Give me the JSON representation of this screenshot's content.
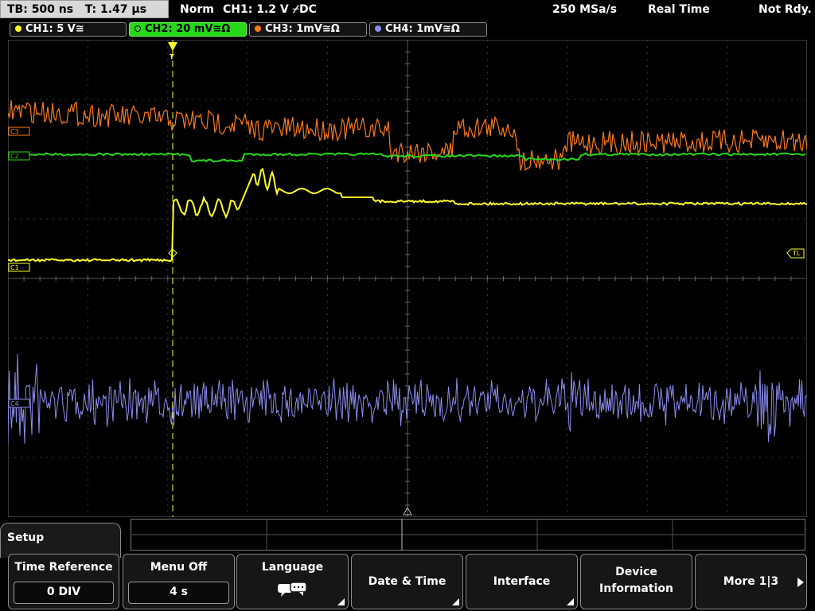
{
  "status_bar": {
    "timebase": "TB: 500 ns",
    "time_offset": "T: 1.47 µs",
    "mode": "Norm",
    "trigger": "CH1: 1.2 V ⌿DC",
    "sample_rate": "250 MSa/s",
    "acquisition": "Real Time",
    "state": "Not Rdy."
  },
  "channels": [
    {
      "label": "CH1: 5 V≅",
      "color": "#ffff2a"
    },
    {
      "label": "CH2: 20 mV≅Ω",
      "color": "#27d81a"
    },
    {
      "label": "CH3: 1mV≅Ω",
      "color": "#ff7a1a"
    },
    {
      "label": "CH4: 1mV≅Ω",
      "color": "#8c8cf0"
    }
  ],
  "markers": {
    "c1": "C1",
    "c2": "C2",
    "c3": "C3",
    "c4": "C4",
    "trigger_level": "TL",
    "trigger_pos": "T"
  },
  "menu": {
    "title": "Setup",
    "softkeys": [
      {
        "label": "Time Reference",
        "value": "0 DIV"
      },
      {
        "label": "Menu Off",
        "value": "4 s"
      },
      {
        "label": "Language",
        "icon": "speech-bubbles-icon"
      },
      {
        "label": "Date & Time"
      },
      {
        "label": "Interface"
      },
      {
        "label_line1": "Device",
        "label_line2": "Information"
      },
      {
        "label": "More 1|3"
      }
    ]
  }
}
